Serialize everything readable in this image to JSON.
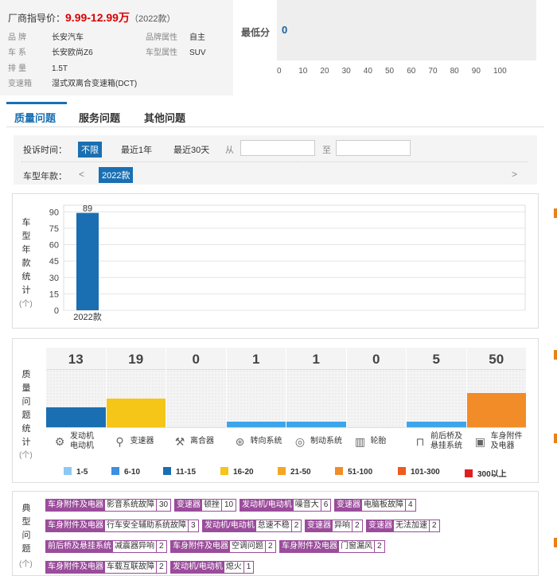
{
  "info": {
    "price_label": "厂商指导价：",
    "price_value": "9.99-12.99万",
    "price_year": "（2022款）",
    "specs": [
      {
        "k": "品牌",
        "v": "长安汽车"
      },
      {
        "k": "车系",
        "v": "长安欧尚Z6"
      },
      {
        "k": "排量",
        "v": "1.5T"
      },
      {
        "k": "变速箱",
        "v": "湿式双离合变速箱(DCT)"
      }
    ],
    "specs_right": [
      {
        "k": "品牌属性",
        "v": "自主"
      },
      {
        "k": "车型属性",
        "v": "SUV"
      }
    ]
  },
  "score": {
    "label": "最低分",
    "value": "0",
    "ticks": [
      "0",
      "10",
      "20",
      "30",
      "40",
      "50",
      "60",
      "70",
      "80",
      "90",
      "100"
    ]
  },
  "tabs": [
    "质量问题",
    "服务问题",
    "其他问题"
  ],
  "filter": {
    "time_label": "投诉时间：",
    "time_options": [
      "不限",
      "最近1年",
      "最近30天"
    ],
    "from_label": "从",
    "to_label": "至",
    "year_label": "车型年款：",
    "prev": "<",
    "next": ">",
    "year_selected": "2022款"
  },
  "year_stats": {
    "side_label": [
      "车",
      "型",
      "年",
      "款",
      "统",
      "计"
    ],
    "unit": "(个)"
  },
  "chart_data": {
    "type": "bar",
    "categories": [
      "2022款"
    ],
    "values": [
      89
    ],
    "yticks": [
      0,
      15,
      30,
      45,
      60,
      75,
      90
    ],
    "ylim": [
      0,
      96
    ],
    "color": "#1a6fb2"
  },
  "quality": {
    "side_label": [
      "质",
      "量",
      "问",
      "题",
      "统",
      "计"
    ],
    "unit": "(个)",
    "items": [
      {
        "name": "发动机\n电动机",
        "count": "13",
        "level": 0.35,
        "color": "#1a6fb2",
        "icon": "engine-icon",
        "glyph": "⚙"
      },
      {
        "name": "变速器",
        "count": "19",
        "level": 0.5,
        "color": "#f5c518",
        "icon": "gearshift-icon",
        "glyph": "⚲"
      },
      {
        "name": "离合器",
        "count": "0",
        "level": 0,
        "color": "#ccc",
        "icon": "clutch-icon",
        "glyph": "⚒"
      },
      {
        "name": "转向系统",
        "count": "1",
        "level": 0.1,
        "color": "#3da5ea",
        "icon": "steering-wheel-icon",
        "glyph": "⊛"
      },
      {
        "name": "制动系统",
        "count": "1",
        "level": 0.1,
        "color": "#3da5ea",
        "icon": "brake-disc-icon",
        "glyph": "◎"
      },
      {
        "name": "轮胎",
        "count": "0",
        "level": 0,
        "color": "#ccc",
        "icon": "tire-icon",
        "glyph": "▥"
      },
      {
        "name": "前后桥及\n悬挂系统",
        "count": "5",
        "level": 0.1,
        "color": "#3da5ea",
        "icon": "axle-icon",
        "glyph": "⊓"
      },
      {
        "name": "车身附件\n及电器",
        "count": "50",
        "level": 0.6,
        "color": "#f28c28",
        "icon": "body-electrics-icon",
        "glyph": "▣"
      }
    ],
    "legend": [
      {
        "label": "1-5",
        "color": "#8cc8f2"
      },
      {
        "label": "6-10",
        "color": "#3d8fe0"
      },
      {
        "label": "11-15",
        "color": "#1a6fb2"
      },
      {
        "label": "16-20",
        "color": "#f5c518"
      },
      {
        "label": "21-50",
        "color": "#f5a623"
      },
      {
        "label": "51-100",
        "color": "#f28c28"
      },
      {
        "label": "101-300",
        "color": "#ef5a1e"
      },
      {
        "label": "300以上",
        "color": "#e02020"
      }
    ]
  },
  "typical": {
    "side_label": [
      "典",
      "型",
      "问",
      "题"
    ],
    "unit": "(个)",
    "rows": [
      [
        {
          "cat": "车身附件及电器",
          "prob": "影音系统故障",
          "n": "30"
        },
        {
          "cat": "变速器",
          "prob": "顿挫",
          "n": "10"
        },
        {
          "cat": "发动机/电动机",
          "prob": "噪音大",
          "n": "6"
        },
        {
          "cat": "变速器",
          "prob": "电脑板故障",
          "n": "4"
        }
      ],
      [
        {
          "cat": "车身附件及电器",
          "prob": "行车安全辅助系统故障",
          "n": "3"
        },
        {
          "cat": "发动机/电动机",
          "prob": "怠速不稳",
          "n": "2"
        },
        {
          "cat": "变速器",
          "prob": "异响",
          "n": "2"
        },
        {
          "cat": "变速器",
          "prob": "无法加速",
          "n": "2"
        }
      ],
      [
        {
          "cat": "前后桥及悬挂系统",
          "prob": "减震器异响",
          "n": "2"
        },
        {
          "cat": "车身附件及电器",
          "prob": "空调问题",
          "n": "2"
        },
        {
          "cat": "车身附件及电器",
          "prob": "门窗漏风",
          "n": "2"
        }
      ],
      [
        {
          "cat": "车身附件及电器",
          "prob": "车载互联故障",
          "n": "2"
        },
        {
          "cat": "发动机/电动机",
          "prob": "熄火",
          "n": "1"
        }
      ]
    ]
  }
}
